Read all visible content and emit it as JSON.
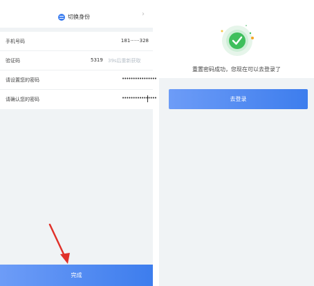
{
  "left": {
    "switch_label": "切换身份",
    "rows": [
      {
        "label": "手机号码",
        "value": "181······328"
      },
      {
        "label": "验证码",
        "value": "5319",
        "resend": "39s后重新获取"
      },
      {
        "label": "请设置您的密码",
        "value": "••••••••••••••••"
      },
      {
        "label": "请确认您的密码",
        "value": "••••••••••••••••"
      }
    ],
    "done_label": "完成"
  },
  "right": {
    "success_message": "重置密码成功，您现在可以去登录了",
    "login_label": "去登录"
  },
  "colors": {
    "accent": "#3d7ded",
    "success": "#3fbf5c",
    "background": "#f0f3f5",
    "annotation": "#e0312a"
  }
}
